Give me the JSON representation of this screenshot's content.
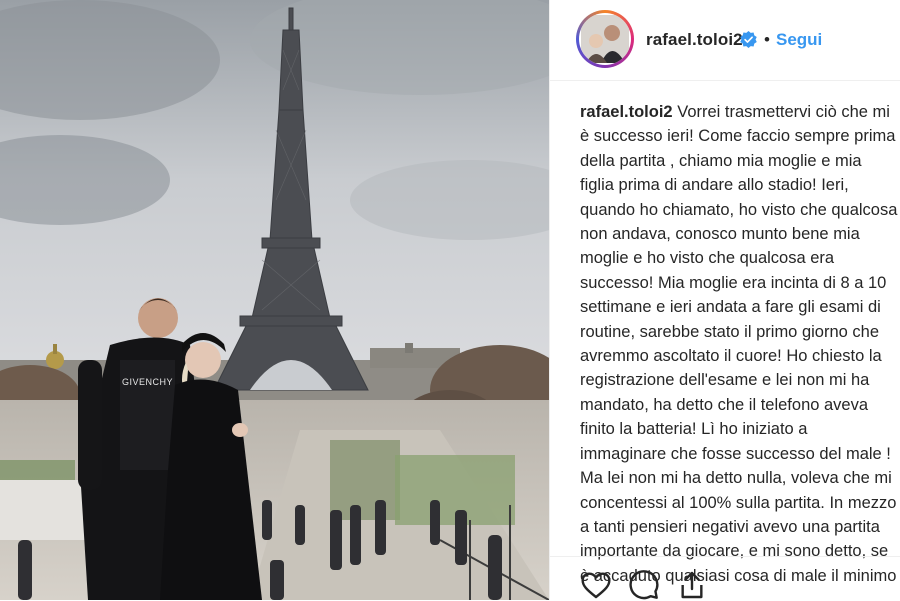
{
  "post": {
    "username": "rafael.toloi2",
    "separator": "•",
    "follow_label": "Segui",
    "verified_icon": "verified-badge-icon",
    "caption": {
      "username": "rafael.toloi2",
      "lines": [
        "Vorrei trasmettervi ciò che mi",
        "è successo ieri! Come faccio sempre prima",
        "della partita , chiamo mia moglie e mia",
        "figlia prima di andare allo stadio! Ieri,",
        "quando ho chiamato, ho visto che qualcosa",
        "non andava, conosco munto bene mia",
        "moglie e ho visto che qualcosa era",
        "successo! Mia moglie era incinta di 8 a 10",
        "settimane e ieri andata a fare gli esami di",
        "routine, sarebbe stato il primo giorno che",
        "avremmo ascoltato il cuore! Ho chiesto la",
        "registrazione dell'esame e lei non mi ha",
        "mandato, ha detto che il telefono aveva",
        "finito la batteria! Lì ho iniziato a",
        "immaginare che fosse successo del male !",
        "Ma lei non mi ha detto nulla, voleva che mi",
        "concentessi al 100% sulla partita. In mezzo",
        "a tanti pensieri negativi avevo una partita",
        "importante da giocare, e mi sono detto, se",
        "è accaduto qualsiasi cosa di male il minimo"
      ]
    },
    "photo": {
      "shirt_text": "GIVENCHY"
    },
    "actions": [
      "heart-icon",
      "comment-icon",
      "share-icon"
    ],
    "colors": {
      "link": "#3897f0",
      "text": "#262626",
      "verified": "#3897f0"
    }
  }
}
